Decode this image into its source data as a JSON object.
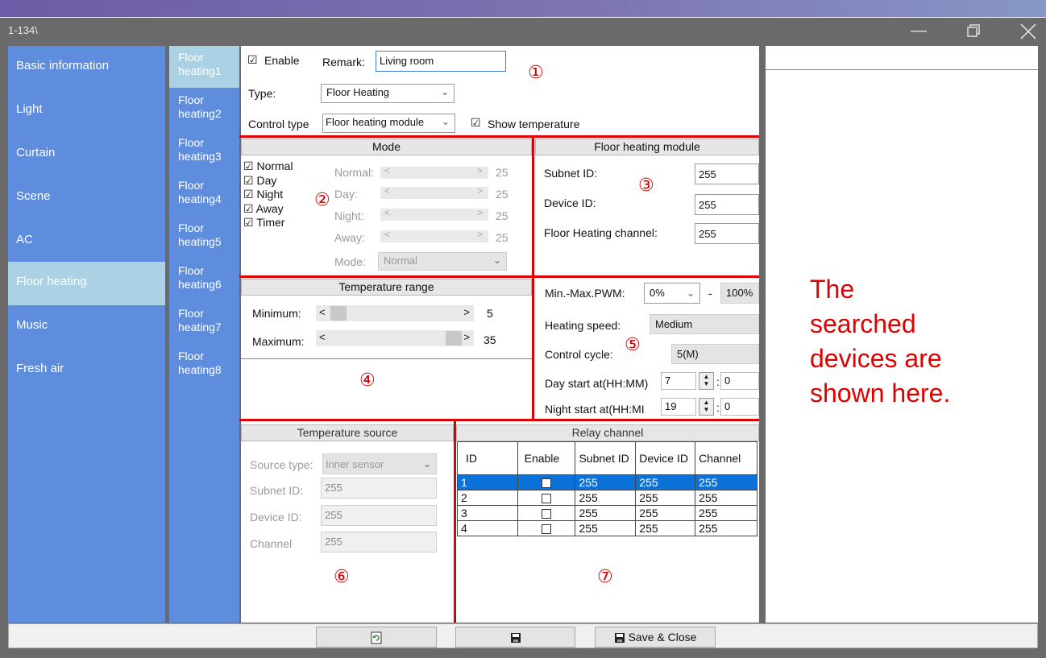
{
  "window": {
    "title": "1-134\\"
  },
  "nav": {
    "items": [
      "Basic information",
      "Light",
      "Curtain",
      "Scene",
      "AC",
      "Floor heating",
      "Music",
      "Fresh air"
    ],
    "selected": "Floor heating"
  },
  "sub": {
    "items": [
      "Floor heating1",
      "Floor heating2",
      "Floor heating3",
      "Floor heating4",
      "Floor heating5",
      "Floor heating6",
      "Floor heating7",
      "Floor heating8"
    ],
    "selected": "Floor heating1"
  },
  "top": {
    "enable_label": "Enable",
    "enable_checked": true,
    "remark_label": "Remark:",
    "remark_value": "Living room",
    "type_label": "Type:",
    "type_value": "Floor Heating",
    "control_type_label": "Control type",
    "control_type_value": "Floor heating module",
    "show_temp_label": "Show temperature",
    "show_temp_checked": true
  },
  "mode": {
    "header": "Mode",
    "checks": [
      "Normal",
      "Day",
      "Night",
      "Away",
      "Timer"
    ],
    "sliders": [
      {
        "label": "Normal:",
        "value": "25"
      },
      {
        "label": "Day:",
        "value": "25"
      },
      {
        "label": "Night:",
        "value": "25"
      },
      {
        "label": "Away:",
        "value": "25"
      }
    ],
    "mode_label": "Mode:",
    "mode_value": "Normal"
  },
  "module": {
    "header": "Floor heating module",
    "subnet_label": "Subnet ID:",
    "subnet_value": "255",
    "device_label": "Device ID:",
    "device_value": "255",
    "channel_label": "Floor Heating channel:",
    "channel_value": "255"
  },
  "temp_range": {
    "header": "Temperature range",
    "min_label": "Minimum:",
    "min_value": "5",
    "max_label": "Maximum:",
    "max_value": "35"
  },
  "settings": {
    "pwm_label": "Min.-Max.PWM:",
    "pwm_min": "0%",
    "pwm_sep": "-",
    "pwm_max": "100%",
    "speed_label": "Heating speed:",
    "speed_value": "Medium",
    "cycle_label": "Control cycle:",
    "cycle_value": "5(M)",
    "day_label": "Day start at(HH:MM)",
    "day_hour": "7",
    "day_min": "0",
    "night_label": "Night start at(HH:MI",
    "night_hour": "19",
    "night_min": "0",
    "colon": ":"
  },
  "temp_source": {
    "header": "Temperature source",
    "source_label": "Source type:",
    "source_value": "Inner sensor",
    "subnet_label": "Subnet ID:",
    "subnet_value": "255",
    "device_label": "Device ID:",
    "device_value": "255",
    "channel_label": "Channel",
    "channel_value": "255"
  },
  "relay": {
    "header": "Relay channel",
    "columns": [
      "ID",
      "Enable",
      "Subnet ID",
      "Device ID",
      "Channel"
    ],
    "rows": [
      {
        "id": "1",
        "subnet": "255",
        "device": "255",
        "channel": "255"
      },
      {
        "id": "2",
        "subnet": "255",
        "device": "255",
        "channel": "255"
      },
      {
        "id": "3",
        "subnet": "255",
        "device": "255",
        "channel": "255"
      },
      {
        "id": "4",
        "subnet": "255",
        "device": "255",
        "channel": "255"
      }
    ]
  },
  "markers": [
    "①",
    "②",
    "③",
    "④",
    "⑤",
    "⑥",
    "⑦"
  ],
  "note": {
    "line1": "The",
    "line2": "searched",
    "line3": "devices are",
    "line4": "shown here."
  },
  "bottom": {
    "refresh_icon": "refresh-icon",
    "save_icon": "save-icon",
    "save_close_label": "Save & Close"
  },
  "colors": {
    "nav_bg": "#5d8ddc",
    "nav_selected": "#aad1e4",
    "accent_red": "#e10000",
    "row_selected": "#0a72d8"
  }
}
